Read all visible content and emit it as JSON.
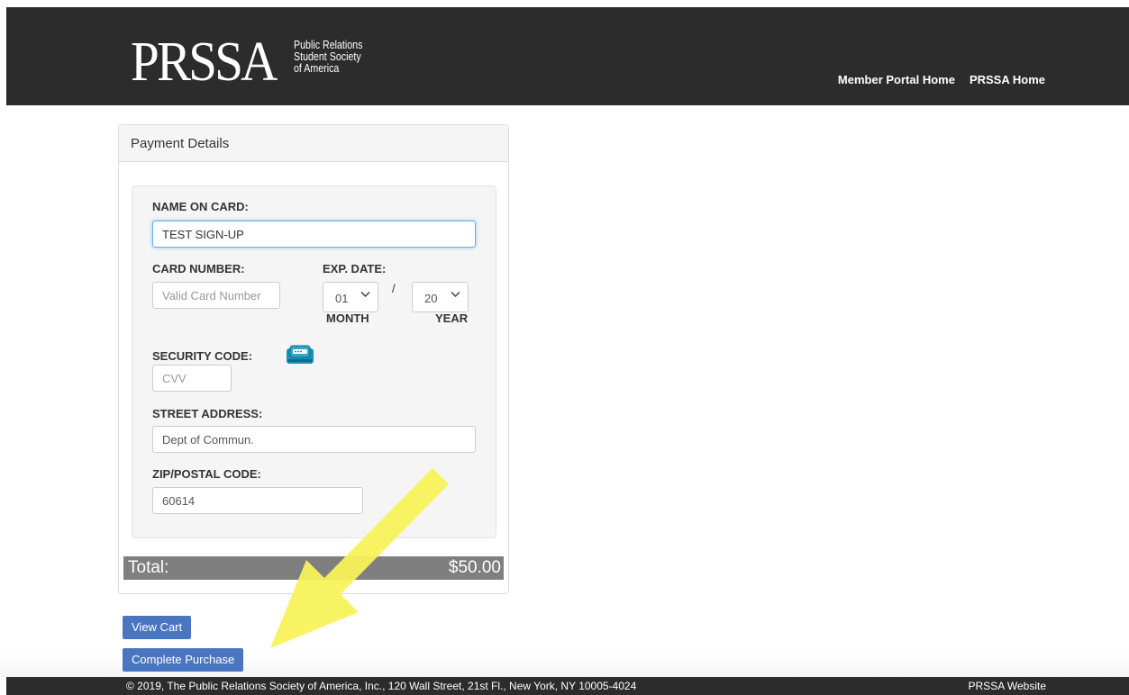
{
  "header": {
    "logo_mark": "PRSSA",
    "logo_lines": [
      "Public Relations",
      "Student Society",
      "of America"
    ],
    "nav": [
      "Member Portal Home",
      "PRSSA Home"
    ]
  },
  "panel": {
    "title": "Payment Details",
    "name_label": "NAME ON CARD:",
    "name_value": "TEST SIGN-UP",
    "card_label": "CARD NUMBER:",
    "card_placeholder": "Valid Card Number",
    "exp_label": "EXP. DATE:",
    "exp_month": "01",
    "exp_year": "20",
    "exp_separator": "/",
    "month_label": "MONTH",
    "year_label": "YEAR",
    "security_label": "SECURITY CODE:",
    "security_icon": "card-cvv-icon",
    "cvv_placeholder": "CVV",
    "street_label": "STREET ADDRESS:",
    "street_value": "Dept of Commun.",
    "zip_label": "ZIP/POSTAL CODE:",
    "zip_value": "60614",
    "total_label": "Total:",
    "total_value": "$50.00"
  },
  "actions": {
    "view_cart": "View Cart",
    "complete_purchase": "Complete Purchase"
  },
  "footer": {
    "copyright": "© 2019, The Public Relations Society of America, Inc., 120 Wall Street, 21st Fl., New York, NY 10005-4024",
    "link": "PRSSA Website"
  },
  "colors": {
    "header_bg": "#2c2c2c",
    "button": "#4a76c1",
    "total_bar": "#7f7f7f",
    "annotation_arrow": "#f7f25a"
  }
}
